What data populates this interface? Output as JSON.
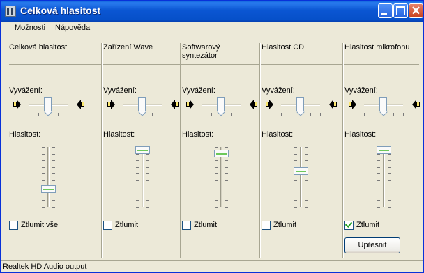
{
  "window": {
    "title": "Celková hlasitost"
  },
  "menu": {
    "items": [
      {
        "label": "Možnosti"
      },
      {
        "label": "Nápověda"
      }
    ]
  },
  "columns": [
    {
      "title": "Celková hlasitost",
      "balance_label": "Vyvážení:",
      "volume_label": "Hlasitost:",
      "balance": 0.5,
      "volume": 0.3,
      "mute_label": "Ztlumit vše",
      "muted": false
    },
    {
      "title": "Zařízení Wave",
      "balance_label": "Vyvážení:",
      "volume_label": "Hlasitost:",
      "balance": 0.5,
      "volume": 0.95,
      "mute_label": "Ztlumit",
      "muted": false
    },
    {
      "title": "Softwarový syntezátor",
      "balance_label": "Vyvážení:",
      "volume_label": "Hlasitost:",
      "balance": 0.5,
      "volume": 0.9,
      "mute_label": "Ztlumit",
      "muted": false
    },
    {
      "title": "Hlasitost CD",
      "balance_label": "Vyvážení:",
      "volume_label": "Hlasitost:",
      "balance": 0.5,
      "volume": 0.6,
      "mute_label": "Ztlumit",
      "muted": false
    },
    {
      "title": "Hlasitost mikrofonu",
      "balance_label": "Vyvážení:",
      "volume_label": "Hlasitost:",
      "balance": 0.5,
      "volume": 0.95,
      "mute_label": "Ztlumit",
      "muted": true,
      "advanced_label": "Upřesnit"
    }
  ],
  "status": {
    "text": "Realtek HD Audio output"
  },
  "colors": {
    "titlebar": "#0a5fd6",
    "face": "#ece9d8",
    "thumb_accent": "#6cc85a",
    "check": "#21a121"
  },
  "icons": {
    "app": "volume-control-icon",
    "minimize": "minimize-icon",
    "maximize": "maximize-icon",
    "close": "close-icon",
    "speaker_left": "speaker-left-icon",
    "speaker_right": "speaker-right-icon"
  }
}
